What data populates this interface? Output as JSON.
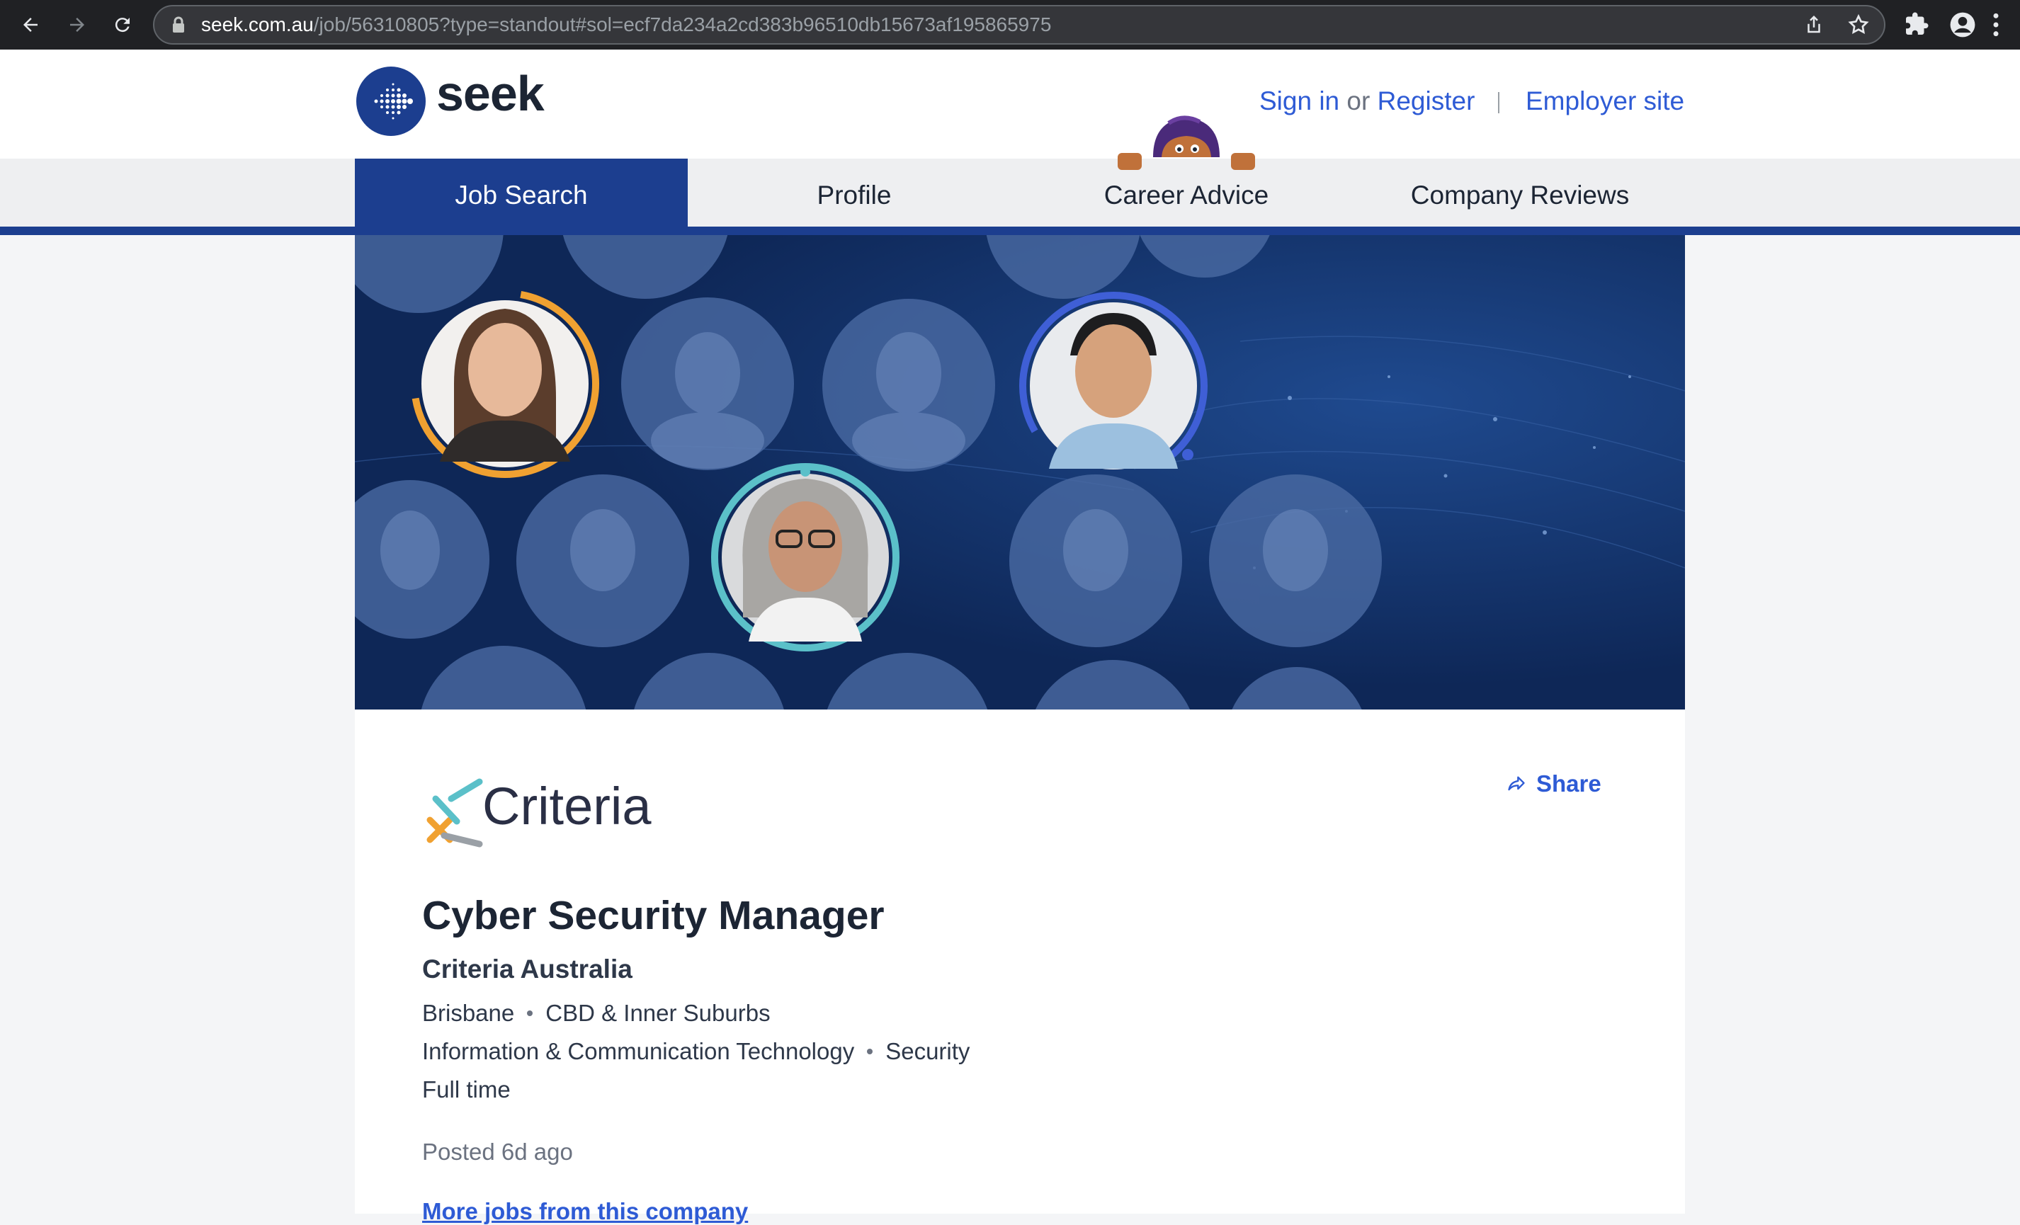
{
  "browser": {
    "url_host": "seek.com.au",
    "url_path": "/job/56310805?type=standout#sol=ecf7da234a2cd383b96510db15673af195865975",
    "icons": [
      "back-icon",
      "forward-icon",
      "reload-icon",
      "lock-icon",
      "share-page-icon",
      "bookmark-star-icon",
      "extensions-icon",
      "profile-icon",
      "menu-icon"
    ]
  },
  "header": {
    "logo_text": "seek",
    "sign_in": "Sign in",
    "or": "or",
    "register": "Register",
    "employer_site": "Employer site"
  },
  "nav": {
    "tabs": [
      {
        "label": "Job Search",
        "active": true
      },
      {
        "label": "Profile",
        "active": false
      },
      {
        "label": "Career Advice",
        "active": false
      },
      {
        "label": "Company Reviews",
        "active": false
      }
    ]
  },
  "job": {
    "company_logo_text": "Criteria",
    "share_label": "Share",
    "title": "Cyber Security Manager",
    "company": "Criteria Australia",
    "location": "Brisbane",
    "area": "CBD & Inner Suburbs",
    "classification": "Information & Communication Technology",
    "subclassification": "Security",
    "work_type": "Full time",
    "posted": "Posted 6d ago",
    "more_jobs_link": "More jobs from this company"
  },
  "colors": {
    "brand_navy": "#1c3e8f",
    "link_blue": "#2e5bd5",
    "banner_bg": "#0f2a5c",
    "ring_orange": "#f0a131",
    "ring_blue": "#3f5fd6",
    "ring_teal": "#5bc0c9"
  }
}
